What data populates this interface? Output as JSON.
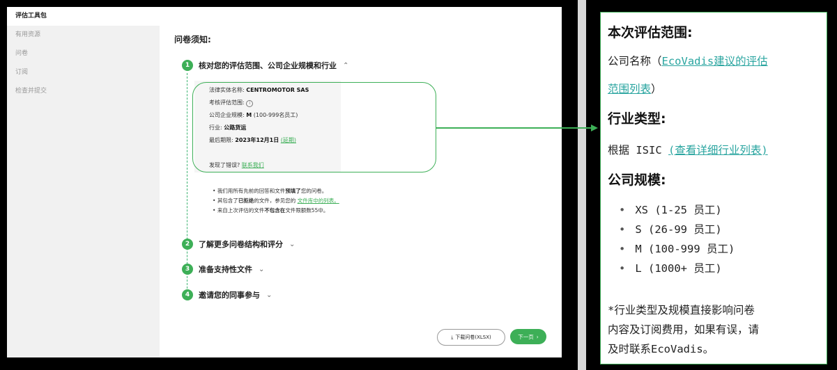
{
  "sidebar": {
    "items": [
      {
        "label": "评估工具包"
      },
      {
        "label": "有用资源"
      },
      {
        "label": "问卷"
      },
      {
        "label": "订阅"
      },
      {
        "label": "检查并提交"
      }
    ]
  },
  "main": {
    "title": "问卷须知:",
    "steps": [
      {
        "num": "1",
        "label": "核对您的评估范围、公司企业规模和行业"
      },
      {
        "num": "2",
        "label": "了解更多问卷结构和评分"
      },
      {
        "num": "3",
        "label": "准备支持性文件"
      },
      {
        "num": "4",
        "label": "邀请您的同事参与"
      }
    ],
    "info": {
      "legal_label": "法律实体名称:",
      "legal_value": "CENTROMOTOR SAS",
      "scope_label": "考核评估范围:",
      "size_label": "公司企业规模:",
      "size_value": "M",
      "size_suffix": "(100-999名员工)",
      "industry_label": "行业:",
      "industry_value": "公路货运",
      "deadline_label": "最后期限:",
      "deadline_value": "2023年12月1日",
      "deadline_link": "(延期)",
      "error_text": "发现了错误?",
      "error_link": "联系我们"
    },
    "bullets": [
      {
        "a": "我们用所有先前的回答和文件",
        "b": "预填了",
        "c": "您的问卷。"
      },
      {
        "a": "其包含了",
        "b": "已拒绝",
        "c": "的文件，参见您的",
        "link": "文件库中的列表。"
      },
      {
        "a": "来自上次评估的文件",
        "b": "不包含在",
        "c": "文件限额数55中。"
      }
    ],
    "download_label": "下载问卷(XLSX)",
    "next_label": "下一页"
  },
  "panel": {
    "scope_heading": "本次评估范围:",
    "company_text": "公司名称（",
    "company_link_1": "EcoVadis建议的评估",
    "company_link_2": "范围列表",
    "company_close": "）",
    "industry_heading": "行业类型:",
    "isic_text": "根据 ISIC",
    "isic_link": "(查看详细行业列表)",
    "size_heading": "公司规模:",
    "sizes": [
      "XS (1-25 员工)",
      "S (26-99 员工)",
      "M (100-999 员工)",
      "L (1000+ 员工)"
    ],
    "note_lines": [
      "*行业类型及规模直接影响问卷",
      "内容及订阅费用，如果有误，请",
      "及时联系EcoVadis。"
    ]
  },
  "colors": {
    "accent": "#3daf57",
    "link": "#2aa5a0"
  }
}
